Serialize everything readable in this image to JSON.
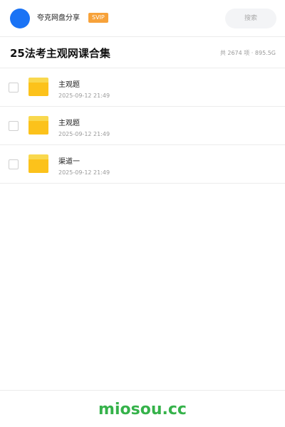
{
  "header": {
    "username": "夸克网盘分享",
    "badge": "SVIP",
    "search_label": "搜索"
  },
  "share": {
    "title": "25法考主观网课合集",
    "stats": "共 2674 项 · 895.5G"
  },
  "files": [
    {
      "name": "主观题",
      "date": "2025-09-12 21:49",
      "icon": "folder-icon"
    },
    {
      "name": "主观题",
      "date": "2025-09-12 21:49",
      "icon": "folder-icon"
    },
    {
      "name": "渠道一",
      "date": "2025-09-12 21:49",
      "icon": "folder-icon"
    }
  ],
  "footer": {
    "brand": "miosou.cc"
  },
  "colors": {
    "avatar": "#1a73f5",
    "badge": "#f7a23a",
    "folder": "#fcc21b",
    "brand": "#35b24a"
  }
}
